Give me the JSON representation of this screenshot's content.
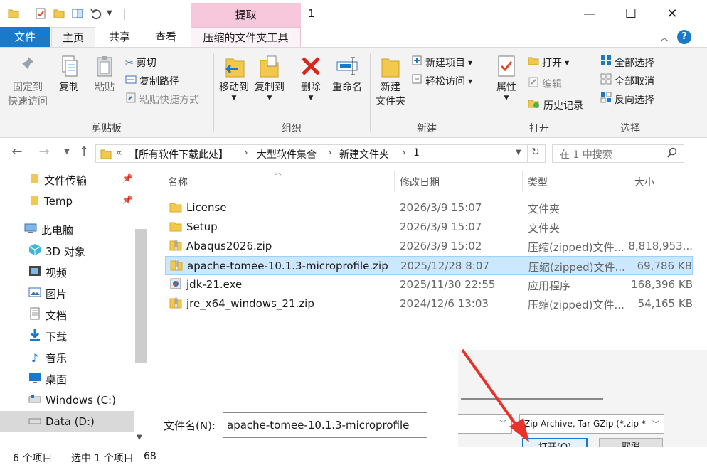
{
  "title_bar": {
    "contextual_tab": "提取",
    "window_title": "1"
  },
  "ribbon_tabs": {
    "file": "文件",
    "home": "主页",
    "share": "共享",
    "view": "查看",
    "tools": "压缩的文件夹工具"
  },
  "ribbon": {
    "clipboard": {
      "pin_quick_access": [
        "固定到",
        "快速访问"
      ],
      "copy": "复制",
      "paste": "粘贴",
      "cut": "剪切",
      "copy_path": "复制路径",
      "paste_shortcut": "粘贴快捷方式",
      "label": "剪贴板"
    },
    "organize": {
      "move_to": "移动到",
      "copy_to": "复制到",
      "delete": "删除",
      "rename": "重命名",
      "label": "组织"
    },
    "new": {
      "new_folder": [
        "新建",
        "文件夹"
      ],
      "new_item": "新建项目",
      "easy_access": "轻松访问",
      "label": "新建"
    },
    "open": {
      "properties": "属性",
      "open": "打开",
      "edit": "编辑",
      "history": "历史记录",
      "label": "打开"
    },
    "select": {
      "select_all": "全部选择",
      "select_none": "全部取消",
      "invert": "反向选择",
      "label": "选择"
    }
  },
  "address": {
    "prefix": "«",
    "crumbs": [
      "【所有软件下载此处】",
      "大型软件集合",
      "新建文件夹",
      "1"
    ],
    "search_placeholder": "在 1 中搜索"
  },
  "nav_pane": {
    "items": [
      {
        "label": "文件传输",
        "pinned": true
      },
      {
        "label": "Temp",
        "pinned": true
      },
      {
        "label": "此电脑"
      },
      {
        "label": "3D 对象"
      },
      {
        "label": "视频"
      },
      {
        "label": "图片"
      },
      {
        "label": "文档"
      },
      {
        "label": "下载"
      },
      {
        "label": "音乐"
      },
      {
        "label": "桌面"
      },
      {
        "label": "Windows (C:)"
      },
      {
        "label": "Data (D:)",
        "selected": true
      }
    ]
  },
  "columns": [
    "名称",
    "修改日期",
    "类型",
    "大小"
  ],
  "files": [
    {
      "name": "License",
      "date": "2026/3/9 15:07",
      "type": "文件夹",
      "size": "",
      "icon": "folder-icon"
    },
    {
      "name": "Setup",
      "date": "2026/3/9 15:07",
      "type": "文件夹",
      "size": "",
      "icon": "folder-icon"
    },
    {
      "name": "Abaqus2026.zip",
      "date": "2026/3/9 15:02",
      "type": "压缩(zipped)文件...",
      "size": "8,818,953...",
      "icon": "zip-icon"
    },
    {
      "name": "apache-tomee-10.1.3-microprofile.zip",
      "date": "2025/12/28 8:07",
      "type": "压缩(zipped)文件...",
      "size": "69,786 KB",
      "icon": "zip-icon",
      "selected": true
    },
    {
      "name": "jdk-21.exe",
      "date": "2025/11/30 22:55",
      "type": "应用程序",
      "size": "168,396 KB",
      "icon": "exe-icon"
    },
    {
      "name": "jre_x64_windows_21.zip",
      "date": "2024/12/6 13:03",
      "type": "压缩(zipped)文件...",
      "size": "54,165 KB",
      "icon": "zip-icon"
    }
  ],
  "dialog": {
    "filename_label": "文件名(N):",
    "filename_value": "apache-tomee-10.1.3-microprofile",
    "filter": "Zip Archive, Tar GZip (*.zip *",
    "open_button": "打开(O)",
    "cancel_button": "取消"
  },
  "status": {
    "count": "6 个项目",
    "selected": "选中 1 个项目",
    "extra": "68"
  },
  "colors": {
    "accent": "#1979ca",
    "context_tab": "#f7c8dc",
    "selection": "#cce8ff",
    "folder": "#f2c94c",
    "arrow": "#e8322b"
  }
}
